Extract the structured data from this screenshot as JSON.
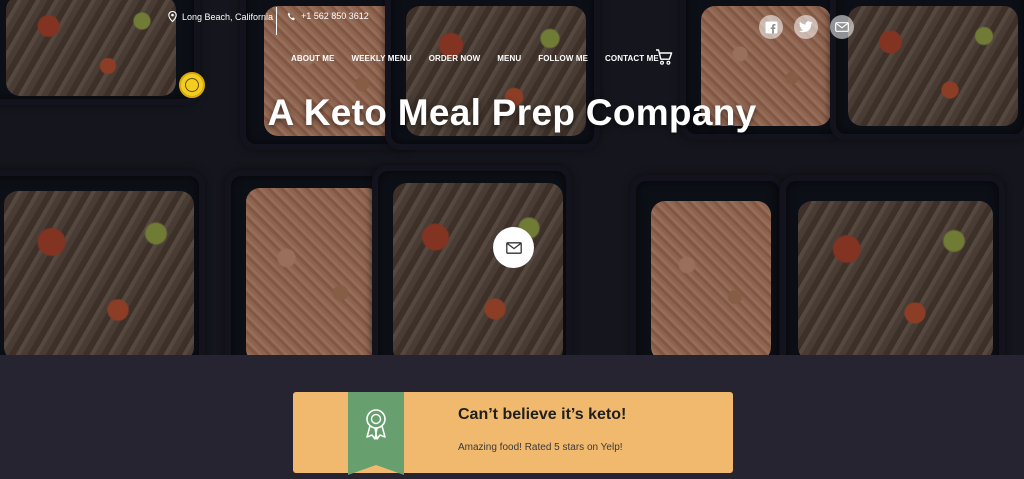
{
  "header": {
    "location": "Long Beach, California",
    "phone": "+1 562 850 3612",
    "social": [
      "facebook-icon",
      "twitter-icon",
      "mail-icon"
    ]
  },
  "nav": {
    "items": [
      "ABOUT ME",
      "WEEKLY MENU",
      "ORDER NOW",
      "MENU",
      "FOLLOW ME",
      "CONTACT ME"
    ]
  },
  "hero": {
    "title": "A Keto Meal Prep Company"
  },
  "review": {
    "title": "Can’t believe it’s keto!",
    "text": "Amazing food! Rated 5 stars on Yelp!"
  },
  "colors": {
    "card": "#f0b96e",
    "ribbon": "#679f6f",
    "page_bg": "#262430"
  }
}
